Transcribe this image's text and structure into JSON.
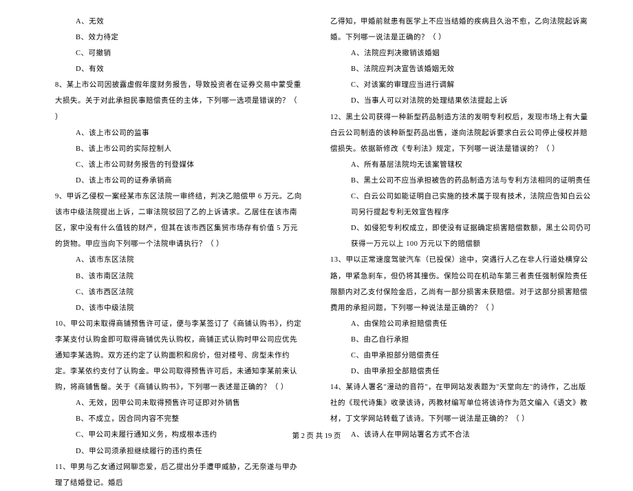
{
  "left": {
    "opts1": [
      "A、无效",
      "B、效力待定",
      "C、可撤销",
      "D、有效"
    ],
    "q8": "8、某上市公司因披露虚假年度财务报告，导致投资者在证券交易中蒙受重大损失。关于对此承担民事赔偿责任的主体，下列哪一选项是错误的？（    ）",
    "opts8": [
      "A、该上市公司的监事",
      "B、该上市公司的实际控制人",
      "C、该上市公司财务报告的刊登媒体",
      "D、该上市公司的证券承销商"
    ],
    "q9": "9、甲诉乙侵权一案经某市东区法院一审终结，判决乙赔偿甲 6 万元。乙向该市中级法院提出上诉，二审法院驳回了乙的上诉请求。乙居住在该市南区，家中没有什么值钱的财产，但其在该市西区集贸市场存有价值 5 万元的货物。甲应当向下列哪一个法院申请执行？（       ）",
    "opts9": [
      "A、该市东区法院",
      "B、该市南区法院",
      "C、该市西区法院",
      "D、该市中级法院"
    ],
    "q10": "10、甲公司未取得商铺预售许可证，便与李某签订了《商铺认购书》，约定李某支付认购金即可取得商铺优先认购权，商铺正式认购时甲公司应优先通知李某选购。双方还约定了认购面积和房价，但对楼号、房型未作约定。李某依约支付了认购金。甲公司取得预售许可后，未通知李某前来认购，将商铺售罄。关于《商铺认购书》，下列哪一表述是正确的？（    ）",
    "opts10": [
      "A、无效，因甲公司未取得预售许可证即对外销售",
      "B、不成立，因合同内容不完整",
      "C、甲公司未履行通知义务，构成根本违约",
      "D、甲公司须承担继续履行的违约责任"
    ],
    "q11": "11、甲男与乙女通过网聊恋爱，后乙提出分手遭甲威胁，乙无奈遂与甲办理了结婚登记。婚后"
  },
  "right": {
    "q11cont": "乙得知，甲婚前就患有医学上不应当结婚的疾病且久治不愈，乙向法院起诉离婚。下列哪一说法是正确的？（    ）",
    "opts11": [
      "A、法院应判决撤销该婚姻",
      "B、法院应判决宣告该婚姻无效",
      "C、对该案的审理应当进行调解",
      "D、当事人可以对法院的处理结果依法提起上诉"
    ],
    "q12": "12、黑土公司获得一种新型药品制造方法的发明专利权后，发现市场上有大量白云公司制造的该种新型药品出售，遂向法院起诉要求白云公司停止侵权并赔偿损失。依据新修改《专利法》规定，下列哪一说法是错误的？（    ）",
    "opts12": [
      "A、所有基层法院均无该案管辖权",
      "B、黑土公司不应当承担被告的药品制造方法与专利方法相同的证明责任",
      "C、白云公司如能证明自己实施的技术属于现有技术，法院应告知白云公司另行提起专利无效宣告程序",
      "D、如侵犯专利权成立，即使没有证据确定损害赔偿数额，黑土公司仍可获得一万元以上 100 万元以下的赔偿额"
    ],
    "q13": "13、甲以正常速度驾驶汽车（已投保）途中，突遇行人乙在非人行道处横穿公路，甲紧急刹车，但仍将其撞伤。保险公司在机动车第三者责任强制保险责任限额内对乙支付保险金后，乙尚有一部分损害未获赔偿。对于这部分损害赔偿费用的承担问题，下列哪一种说法是正确的？（    ）",
    "opts13": [
      "A、由保险公司承担赔偿责任",
      "B、由乙自行承担",
      "C、由甲承担部分赔偿责任",
      "D、由甲承担全部赔偿责任"
    ],
    "q14": "14、某诗人署名\"漫动的音符\"，在甲网站发表题为\"天堂向左\"的诗作，乙出版社的《现代诗集》收录该诗，丙教材编写单位将该诗作为范文编入《语文》教材，丁文学网站转载了该诗。下列哪一说法是正确的？（    ）",
    "opt14a": "A、该诗人在甲网站署名方式不合法"
  },
  "footer": "第 2 页 共 19 页"
}
